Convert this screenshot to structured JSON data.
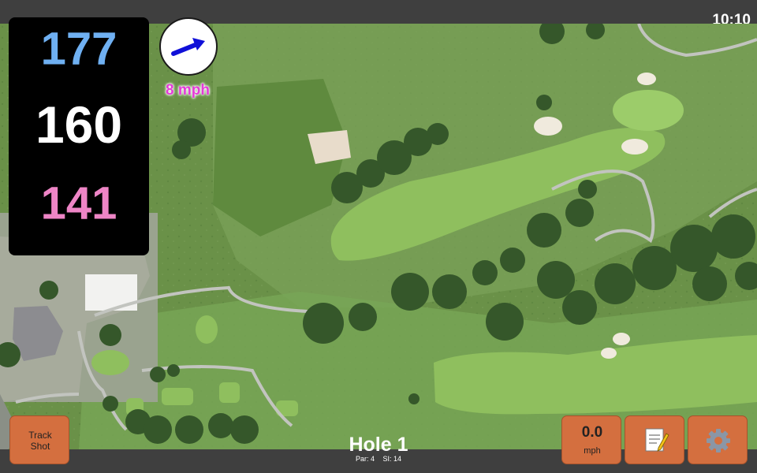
{
  "status_bar": {
    "time": "10:10"
  },
  "distances": {
    "back": "177",
    "middle": "160",
    "front": "141"
  },
  "wind": {
    "speed": "8 mph",
    "direction_icon": "wind-arrow-icon"
  },
  "buttons": {
    "track_shot": "Track\nShot",
    "speed_value": "0.0",
    "speed_unit": "mph",
    "notes_icon": "notepad-icon",
    "settings_icon": "gear-icon"
  },
  "hole": {
    "title": "Hole 1",
    "par": "Par: 4",
    "si": "SI: 14"
  },
  "colors": {
    "back_distance": "#6fb0f2",
    "middle_distance": "#ffffff",
    "front_distance": "#ee85c6",
    "wind_text": "#e43bd8",
    "button": "#d46f3f",
    "arrow": "#1010d8"
  }
}
